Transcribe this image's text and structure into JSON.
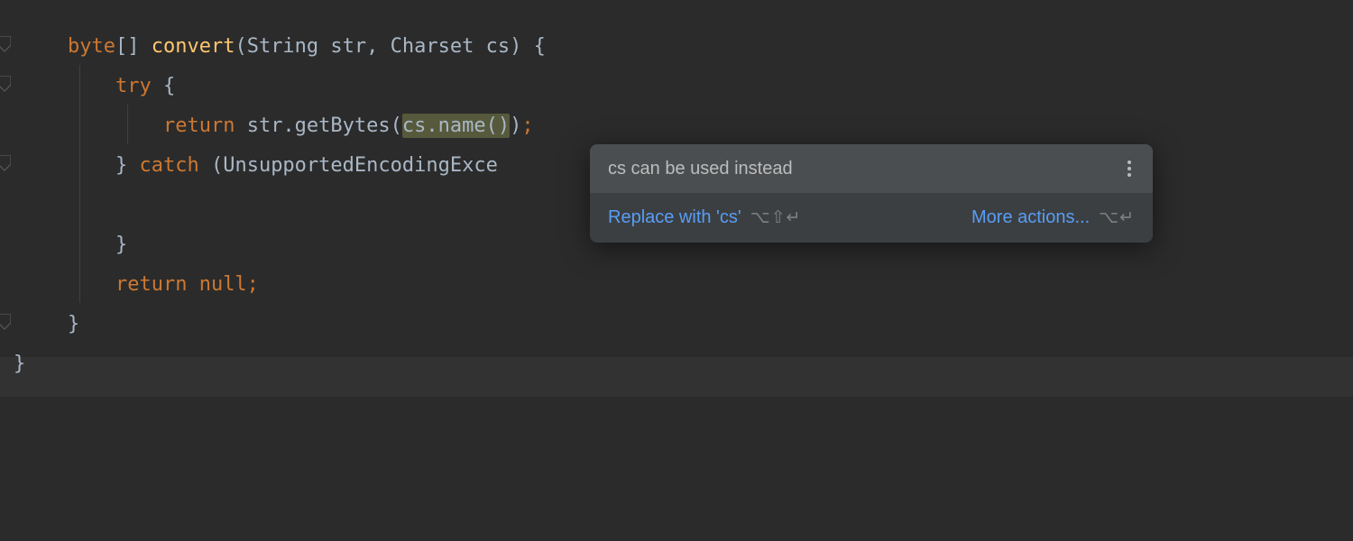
{
  "code": {
    "line1": {
      "t1": "byte",
      "t2": "[] ",
      "t3": "convert",
      "t4": "(String str, Charset cs) {"
    },
    "line2": {
      "t1": "    ",
      "t2": "try",
      "t3": " {"
    },
    "line3": {
      "t1": "        ",
      "t2": "return",
      "t3": " str.getBytes(",
      "hl": "cs.name()",
      "t4": ")",
      "t5": ";"
    },
    "line4": {
      "t1": "    } ",
      "t2": "catch",
      "t3": " (UnsupportedEncodingExce"
    },
    "line5": {
      "t1": ""
    },
    "line6": {
      "t1": "    }"
    },
    "line7": {
      "t1": "    ",
      "t2": "return null;"
    },
    "line8": {
      "t1": "}"
    },
    "line9": {
      "t1": "}"
    }
  },
  "popup": {
    "title": "cs can be used instead",
    "action1": "Replace with 'cs'",
    "shortcut1": "⌥⇧↵",
    "action2": "More actions...",
    "shortcut2": "⌥↵"
  }
}
